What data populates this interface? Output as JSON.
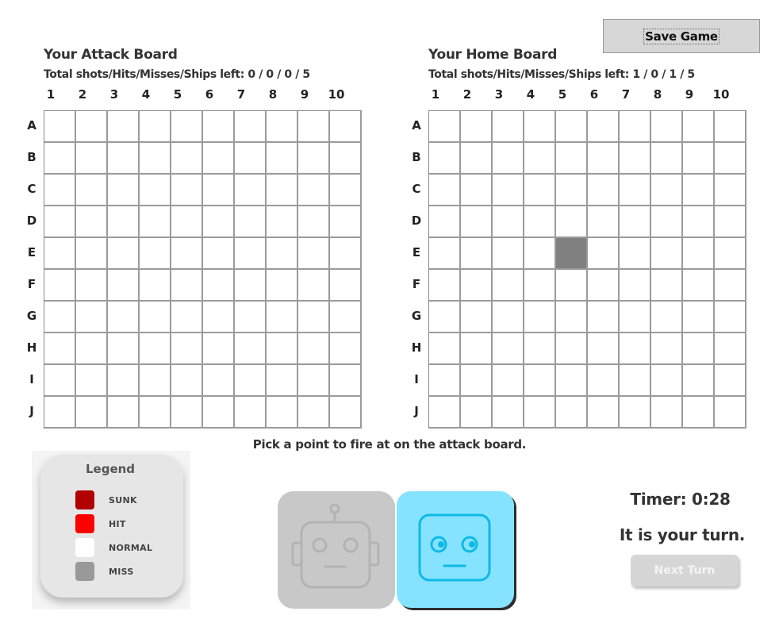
{
  "toolbar": {
    "save_label": "Save Game"
  },
  "attack_board": {
    "title": "Your Attack Board",
    "stats": "Total shots/Hits/Misses/Ships left: 0 / 0 / 0 / 5",
    "columns": [
      "1",
      "2",
      "3",
      "4",
      "5",
      "6",
      "7",
      "8",
      "9",
      "10"
    ],
    "rows": [
      "A",
      "B",
      "C",
      "D",
      "E",
      "F",
      "G",
      "H",
      "I",
      "J"
    ],
    "marked_cells": []
  },
  "home_board": {
    "title": "Your Home Board",
    "stats": "Total shots/Hits/Misses/Ships left: 1 / 0 / 1 / 5",
    "columns": [
      "1",
      "2",
      "3",
      "4",
      "5",
      "6",
      "7",
      "8",
      "9",
      "10"
    ],
    "rows": [
      "A",
      "B",
      "C",
      "D",
      "E",
      "F",
      "G",
      "H",
      "I",
      "J"
    ],
    "marked_cells": [
      {
        "row": "E",
        "col": "5",
        "state": "miss"
      }
    ]
  },
  "status": {
    "message": "Pick a point to fire at on the attack board."
  },
  "legend": {
    "title": "Legend",
    "items": [
      {
        "label": "SUNK",
        "color": "#b00000"
      },
      {
        "label": "HIT",
        "color": "#ff0000"
      },
      {
        "label": "NORMAL",
        "color": "#ffffff"
      },
      {
        "label": "MISS",
        "color": "#999999"
      }
    ]
  },
  "players": {
    "opponent": {
      "icon": "robot-icon",
      "active": false,
      "color": "#c8c8c8"
    },
    "you": {
      "icon": "face-icon",
      "active": true,
      "color": "#85e3ff"
    }
  },
  "timer": {
    "label": "Timer: 0:28"
  },
  "turn": {
    "message": "It is your turn.",
    "next_label": "Next Turn"
  }
}
